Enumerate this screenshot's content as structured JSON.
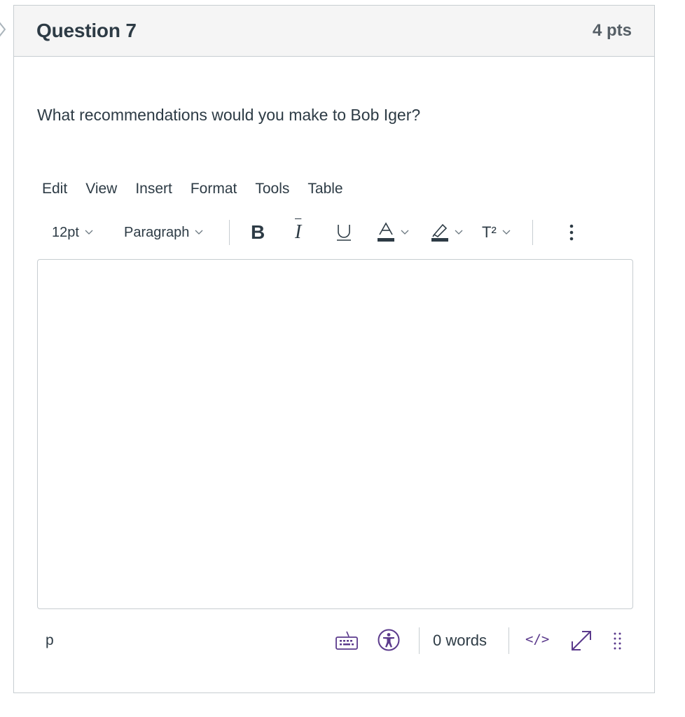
{
  "question": {
    "title": "Question 7",
    "points": "4 pts",
    "prompt": "What recommendations would you make to Bob Iger?"
  },
  "editor": {
    "menubar": [
      "Edit",
      "View",
      "Insert",
      "Format",
      "Tools",
      "Table"
    ],
    "toolbar": {
      "font_size": "12pt",
      "block_format": "Paragraph",
      "bold_label": "B",
      "italic_label": "I",
      "underline_label": "U",
      "superscript_label": "T²",
      "icons": [
        "bold-icon",
        "italic-icon",
        "underline-icon",
        "text-color-icon",
        "highlight-icon",
        "superscript-icon",
        "more-options-icon"
      ]
    },
    "content": "",
    "statusbar": {
      "element_path": "p",
      "word_count": "0 words",
      "html_editor_label": "</>",
      "icons": [
        "keyboard-icon",
        "accessibility-icon",
        "fullscreen-icon",
        "resize-handle-icon"
      ]
    }
  },
  "colors": {
    "accent": "#5b3a8c",
    "text": "#2d3b45",
    "border": "#c7cdd1",
    "header_bg": "#f5f5f5"
  }
}
